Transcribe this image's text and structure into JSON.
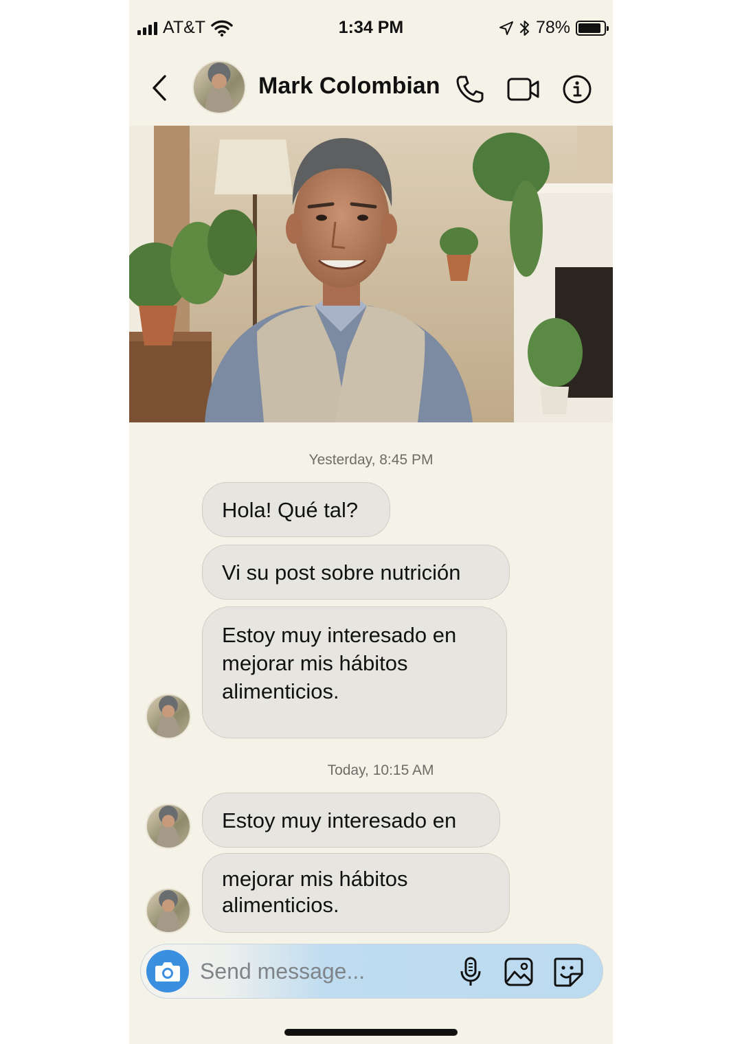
{
  "status_bar": {
    "carrier": "AT&T",
    "time": "1:34 PM",
    "battery_percent": "78%",
    "battery_level": 0.9,
    "icons": [
      "signal-icon",
      "wifi-icon",
      "location-icon",
      "bluetooth-icon",
      "battery-icon"
    ]
  },
  "header": {
    "contact_name": "Mark Colombian",
    "icons": [
      "back-chevron-icon",
      "phone-icon",
      "video-camera-icon",
      "info-icon"
    ]
  },
  "chat": {
    "groups": [
      {
        "timestamp": "Yesterday, 8:45 PM",
        "messages": [
          "Hola! Qué tal?",
          "Vi su post sobre nutrición",
          "Estoy muy interesado en mejorar mis hábitos alimenticios."
        ]
      },
      {
        "timestamp": "Today, 10:15 AM",
        "messages": [
          "Estoy muy interesado en",
          "mejorar mis hábitos alimenticios."
        ]
      }
    ]
  },
  "composer": {
    "placeholder": "Send message...",
    "icons": [
      "camera-icon",
      "microphone-icon",
      "image-icon",
      "sticker-icon"
    ]
  },
  "colors": {
    "background": "#f5f3e8",
    "bubble": "#e6e5e0",
    "accent_blue": "#3b8fe0",
    "composer_tint": "#bcdaf0"
  }
}
